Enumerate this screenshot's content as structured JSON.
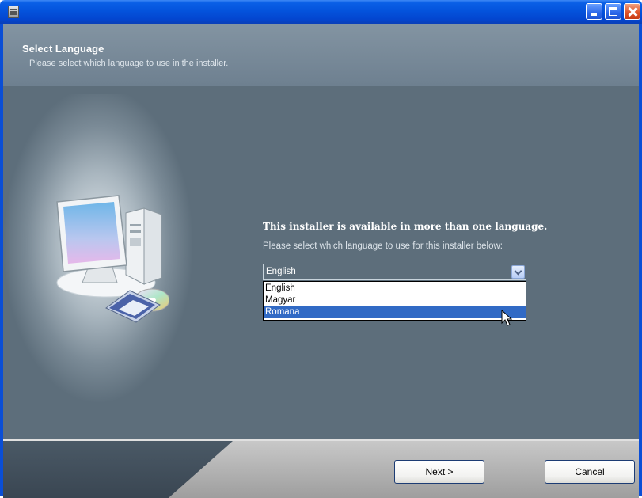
{
  "window": {
    "title": "",
    "controls": [
      "minimize",
      "maximize",
      "close"
    ]
  },
  "header": {
    "title": "Select Language",
    "subtitle": "Please select which language to use in the installer."
  },
  "main": {
    "intro_heading": "This installer is available in more than one language.",
    "intro_text": "Please select which language to use for this installer below:",
    "language_select": {
      "value": "English",
      "options": [
        "English",
        "Magyar",
        "Romana"
      ],
      "highlighted": "Romana"
    }
  },
  "footer": {
    "next_label": "Next >",
    "cancel_label": "Cancel"
  },
  "colors": {
    "titlebar": "#0453dc",
    "body_background": "#5d6e7b",
    "selection": "#316ac5"
  }
}
